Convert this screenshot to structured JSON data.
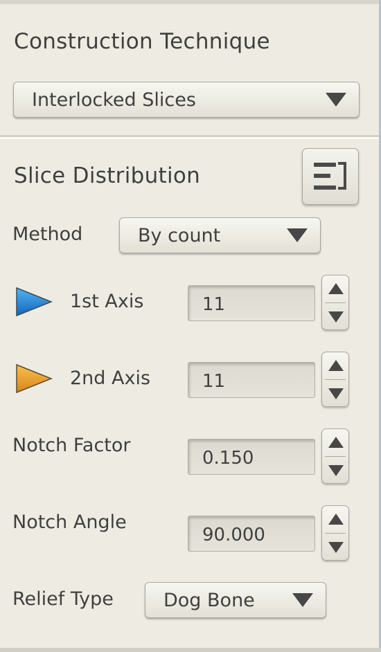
{
  "construction": {
    "title": "Construction Technique",
    "technique_value": "Interlocked Slices"
  },
  "distribution": {
    "title": "Slice Distribution",
    "method_label": "Method",
    "method_value": "By count",
    "axis1_label": "1st Axis",
    "axis1_value": "11",
    "axis1_color": "#1f7fd6",
    "axis2_label": "2nd Axis",
    "axis2_value": "11",
    "axis2_color": "#e59a24",
    "notch_factor_label": "Notch Factor",
    "notch_factor_value": "0.150",
    "notch_angle_label": "Notch Angle",
    "notch_angle_value": "90.000",
    "relief_type_label": "Relief Type",
    "relief_type_value": "Dog Bone"
  },
  "icons": {
    "toggle": "list-toggle-icon",
    "axis1": "blue-triangle-icon",
    "axis2": "orange-triangle-icon",
    "dropdown_arrow": "chevron-down-icon",
    "spin_up": "spin-up-icon",
    "spin_down": "spin-down-icon"
  }
}
